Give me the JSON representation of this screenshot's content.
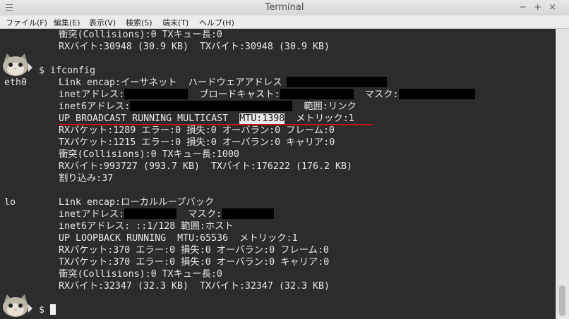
{
  "window": {
    "title": "Terminal",
    "controls": [
      "−",
      "+",
      "×"
    ]
  },
  "menu": [
    "ファイル(F)",
    "編集(E)",
    "表示(V)",
    "検索(S)",
    "端末(T)",
    "ヘルプ(H)"
  ],
  "terminal": {
    "prev_collisions": "衝突(Collisions):0 TXキュー長:0",
    "prev_bytes": "RXバイト:30948 (30.9 KB)  TXバイト:30948 (30.9 KB)",
    "prompt1": "$ ifconfig",
    "eth0": {
      "name": "eth0",
      "link": "Link encap:イーサネット  ハードウェアアドレス",
      "inet": "inetアドレス:",
      "broadcast": "ブロードキャスト:",
      "mask": "マスク:",
      "inet6": "inet6アドレス:",
      "scope": "範囲:リンク",
      "flags": "UP BROADCAST RUNNING MULTICAST  ",
      "mtu": "MTU:1398",
      "metric": "  メトリック:1",
      "rx_packets": "RXパケット:1289 エラー:0 損失:0 オーバラン:0 フレーム:0",
      "tx_packets": "TXパケット:1215 エラー:0 損失:0 オーバラン:0 キャリア:0",
      "collisions": "衝突(Collisions):0 TXキュー長:1000",
      "bytes": "RXバイト:993727 (993.7 KB)  TXバイト:176222 (176.2 KB)",
      "irq": "割り込み:37"
    },
    "lo": {
      "name": "lo",
      "link": "Link encap:ローカルループバック",
      "inet": "inetアドレス:",
      "mask": "マスク:",
      "inet6": "inet6アドレス: ::1/128 範囲:ホスト",
      "flags": "UP LOOPBACK RUNNING  MTU:65536  メトリック:1",
      "rx_packets": "RXパケット:370 エラー:0 損失:0 オーバラン:0 フレーム:0",
      "tx_packets": "TXパケット:370 エラー:0 損失:0 オーバラン:0 キャリア:0",
      "collisions": "衝突(Collisions):0 TXキュー長:0",
      "bytes": "RXバイト:32347 (32.3 KB)  TXバイト:32347 (32.3 KB)"
    },
    "prompt2": "$ "
  },
  "colors": {
    "background": "#2c2c2c",
    "text": "#e8e8e8",
    "underline": "#c0121a"
  }
}
